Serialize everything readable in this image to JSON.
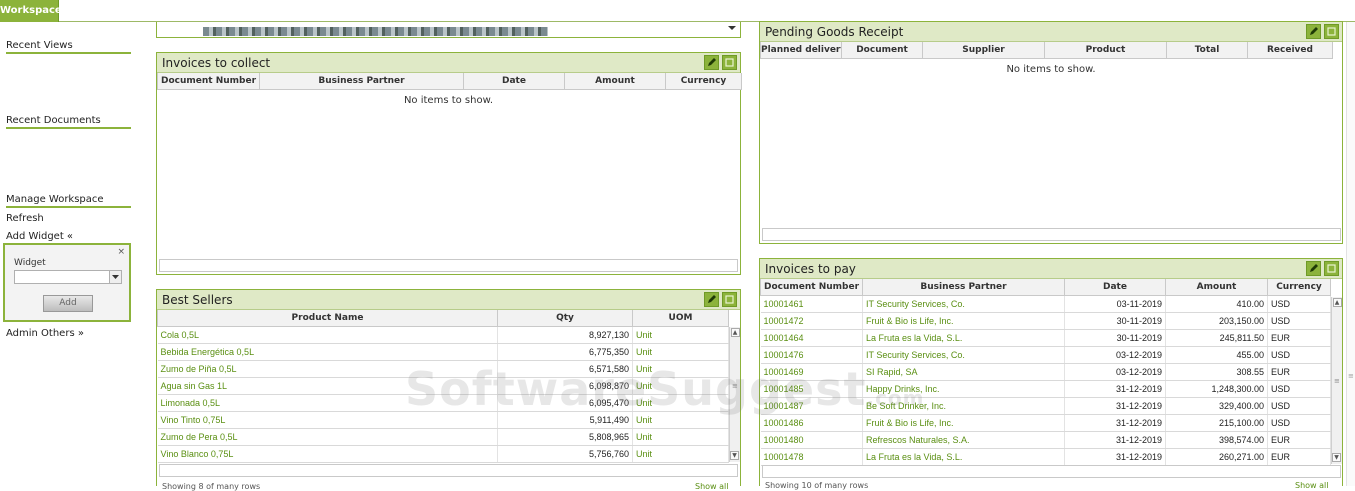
{
  "tab": {
    "label": "Workspace"
  },
  "sidebar": {
    "recent_views": "Recent Views",
    "recent_documents": "Recent Documents",
    "manage_workspace": "Manage Workspace",
    "refresh": "Refresh",
    "add_widget": "Add Widget «",
    "widget_label": "Widget",
    "add_button": "Add",
    "admin_others": "Admin Others »",
    "close_glyph": "×"
  },
  "invoices_to_collect": {
    "title": "Invoices to collect",
    "columns": [
      "Document Number",
      "Business Partner",
      "Date",
      "Amount",
      "Currency"
    ],
    "empty": "No items to show."
  },
  "best_sellers": {
    "title": "Best Sellers",
    "columns": [
      "Product Name",
      "Qty",
      "UOM"
    ],
    "rows": [
      {
        "name": "Cola 0,5L",
        "qty": "8,927,130",
        "uom": "Unit"
      },
      {
        "name": "Bebida Energética 0,5L",
        "qty": "6,775,350",
        "uom": "Unit"
      },
      {
        "name": "Zumo de Piña 0,5L",
        "qty": "6,571,580",
        "uom": "Unit"
      },
      {
        "name": "Agua sin Gas 1L",
        "qty": "6,098,870",
        "uom": "Unit"
      },
      {
        "name": "Limonada 0,5L",
        "qty": "6,095,470",
        "uom": "Unit"
      },
      {
        "name": "Vino Tinto 0,75L",
        "qty": "5,911,490",
        "uom": "Unit"
      },
      {
        "name": "Zumo de Pera 0,5L",
        "qty": "5,808,965",
        "uom": "Unit"
      },
      {
        "name": "Vino Blanco 0,75L",
        "qty": "5,756,760",
        "uom": "Unit"
      }
    ],
    "footer_left": "Showing 8 of many rows",
    "footer_right": "Show all"
  },
  "pending_goods": {
    "title": "Pending Goods Receipt",
    "columns": [
      "Planned delivery",
      "Document",
      "Supplier",
      "Product",
      "Total",
      "Received"
    ],
    "empty": "No items to show."
  },
  "invoices_to_pay": {
    "title": "Invoices to pay",
    "columns": [
      "Document Number",
      "Business Partner",
      "Date",
      "Amount",
      "Currency"
    ],
    "rows": [
      {
        "doc": "10001461",
        "partner": "IT Security Services, Co.",
        "date": "03-11-2019",
        "amount": "410.00",
        "currency": "USD"
      },
      {
        "doc": "10001472",
        "partner": "Fruit & Bio is Life, Inc.",
        "date": "30-11-2019",
        "amount": "203,150.00",
        "currency": "USD"
      },
      {
        "doc": "10001464",
        "partner": "La Fruta es la Vida, S.L.",
        "date": "30-11-2019",
        "amount": "245,811.50",
        "currency": "EUR"
      },
      {
        "doc": "10001476",
        "partner": "IT Security Services, Co.",
        "date": "03-12-2019",
        "amount": "455.00",
        "currency": "USD"
      },
      {
        "doc": "10001469",
        "partner": "SI Rapid, SA",
        "date": "03-12-2019",
        "amount": "308.55",
        "currency": "EUR"
      },
      {
        "doc": "10001485",
        "partner": "Happy Drinks, Inc.",
        "date": "31-12-2019",
        "amount": "1,248,300.00",
        "currency": "USD"
      },
      {
        "doc": "10001487",
        "partner": "Be Soft Drinker, Inc.",
        "date": "31-12-2019",
        "amount": "329,400.00",
        "currency": "USD"
      },
      {
        "doc": "10001486",
        "partner": "Fruit & Bio is Life, Inc.",
        "date": "31-12-2019",
        "amount": "215,100.00",
        "currency": "USD"
      },
      {
        "doc": "10001480",
        "partner": "Refrescos Naturales, S.A.",
        "date": "31-12-2019",
        "amount": "398,574.00",
        "currency": "EUR"
      },
      {
        "doc": "10001478",
        "partner": "La Fruta es la Vida, S.L.",
        "date": "31-12-2019",
        "amount": "260,271.00",
        "currency": "EUR"
      }
    ],
    "footer_left": "Showing 10 of many rows",
    "footer_right": "Show all"
  },
  "watermark": {
    "main": "SoftwareSuggest",
    "suffix": ".com"
  },
  "colors": {
    "accent": "#8cb33b",
    "header_bg": "#dfe9c6",
    "link_green": "#5a8f12"
  }
}
